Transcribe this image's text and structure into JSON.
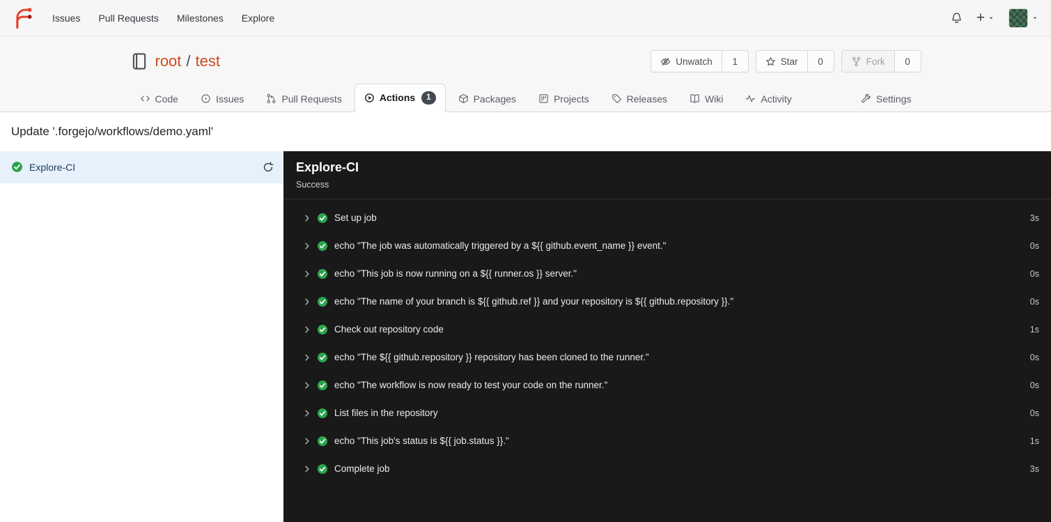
{
  "navbar": {
    "items": [
      {
        "label": "Issues"
      },
      {
        "label": "Pull Requests"
      },
      {
        "label": "Milestones"
      },
      {
        "label": "Explore"
      }
    ]
  },
  "repo": {
    "owner": "root",
    "separator": "/",
    "name": "test",
    "watch": {
      "label": "Unwatch",
      "count": "1"
    },
    "star": {
      "label": "Star",
      "count": "0"
    },
    "fork": {
      "label": "Fork",
      "count": "0"
    }
  },
  "tabs": [
    {
      "label": "Code"
    },
    {
      "label": "Issues"
    },
    {
      "label": "Pull Requests"
    },
    {
      "label": "Actions",
      "badge": "1"
    },
    {
      "label": "Packages"
    },
    {
      "label": "Projects"
    },
    {
      "label": "Releases"
    },
    {
      "label": "Wiki"
    },
    {
      "label": "Activity"
    },
    {
      "label": "Settings"
    }
  ],
  "run": {
    "title": "Update '.forgejo/workflows/demo.yaml'"
  },
  "sidebar": {
    "job": {
      "name": "Explore-CI"
    }
  },
  "panel": {
    "title": "Explore-CI",
    "status": "Success"
  },
  "steps": [
    {
      "name": "Set up job",
      "duration": "3s"
    },
    {
      "name": "echo \"The job was automatically triggered by a ${{ github.event_name }} event.\"",
      "duration": "0s"
    },
    {
      "name": "echo \"This job is now running on a ${{ runner.os }} server.\"",
      "duration": "0s"
    },
    {
      "name": "echo \"The name of your branch is ${{ github.ref }} and your repository is ${{ github.repository }}.\"",
      "duration": "0s"
    },
    {
      "name": "Check out repository code",
      "duration": "1s"
    },
    {
      "name": "echo \"The ${{ github.repository }} repository has been cloned to the runner.\"",
      "duration": "0s"
    },
    {
      "name": "echo \"The workflow is now ready to test your code on the runner.\"",
      "duration": "0s"
    },
    {
      "name": "List files in the repository",
      "duration": "0s"
    },
    {
      "name": "echo \"This job's status is ${{ job.status }}.\"",
      "duration": "1s"
    },
    {
      "name": "Complete job",
      "duration": "3s"
    }
  ],
  "colors": {
    "accent": "#d0491f",
    "success_green": "#2da44e",
    "active_job_bg": "#e7f1fb",
    "panel_bg": "#191919"
  }
}
